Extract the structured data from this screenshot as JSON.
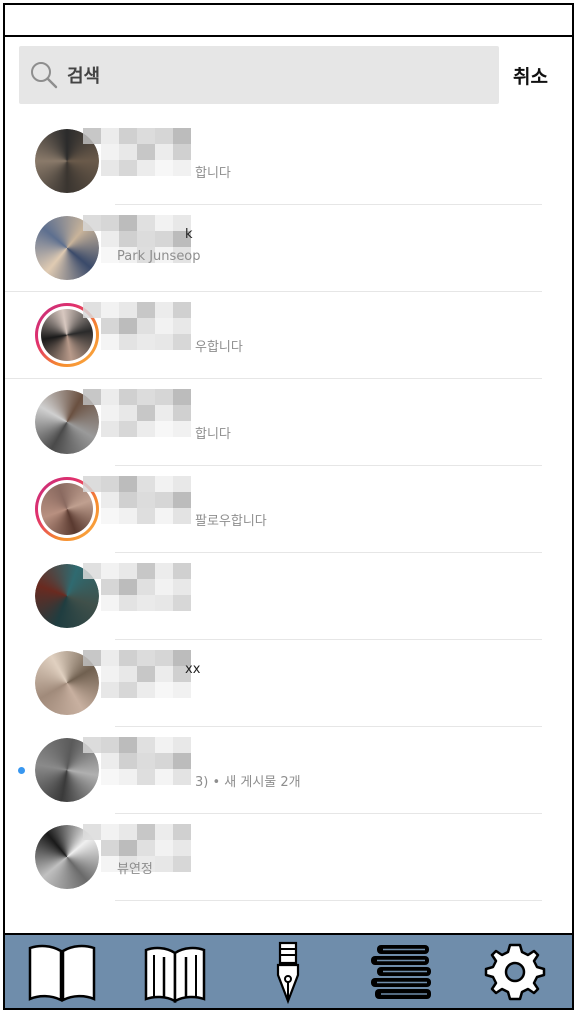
{
  "search": {
    "placeholder": "검색",
    "cancel_label": "취소"
  },
  "results": [
    {
      "name": "",
      "subtitle": "합니다",
      "ring": false,
      "unread": false,
      "full_divider": false
    },
    {
      "name": "k",
      "subtitle": "Park Junseop",
      "ring": false,
      "unread": false,
      "full_divider": true
    },
    {
      "name": "",
      "subtitle": "우합니다",
      "ring": true,
      "unread": false,
      "full_divider": true
    },
    {
      "name": "",
      "subtitle": "합니다",
      "ring": false,
      "unread": false,
      "full_divider": false
    },
    {
      "name": "",
      "subtitle": "팔로우합니다",
      "ring": true,
      "unread": false,
      "full_divider": false
    },
    {
      "name": "",
      "subtitle": "",
      "ring": false,
      "unread": false,
      "full_divider": false
    },
    {
      "name": "xx",
      "subtitle": "",
      "ring": false,
      "unread": false,
      "full_divider": false
    },
    {
      "name": "",
      "subtitle": "3) • 새 게시물 2개",
      "ring": false,
      "unread": true,
      "full_divider": false
    },
    {
      "name": "",
      "subtitle": "뷰연정",
      "ring": false,
      "unread": false,
      "full_divider": false
    }
  ],
  "nav": [
    {
      "icon": "open-book-icon"
    },
    {
      "icon": "reading-book-icon"
    },
    {
      "icon": "fountain-pen-icon"
    },
    {
      "icon": "book-stack-icon"
    },
    {
      "icon": "gear-icon"
    }
  ],
  "colors": {
    "nav_background": "#6f8dab",
    "search_background": "#e6e6e6",
    "unread_dot": "#3897f0"
  }
}
